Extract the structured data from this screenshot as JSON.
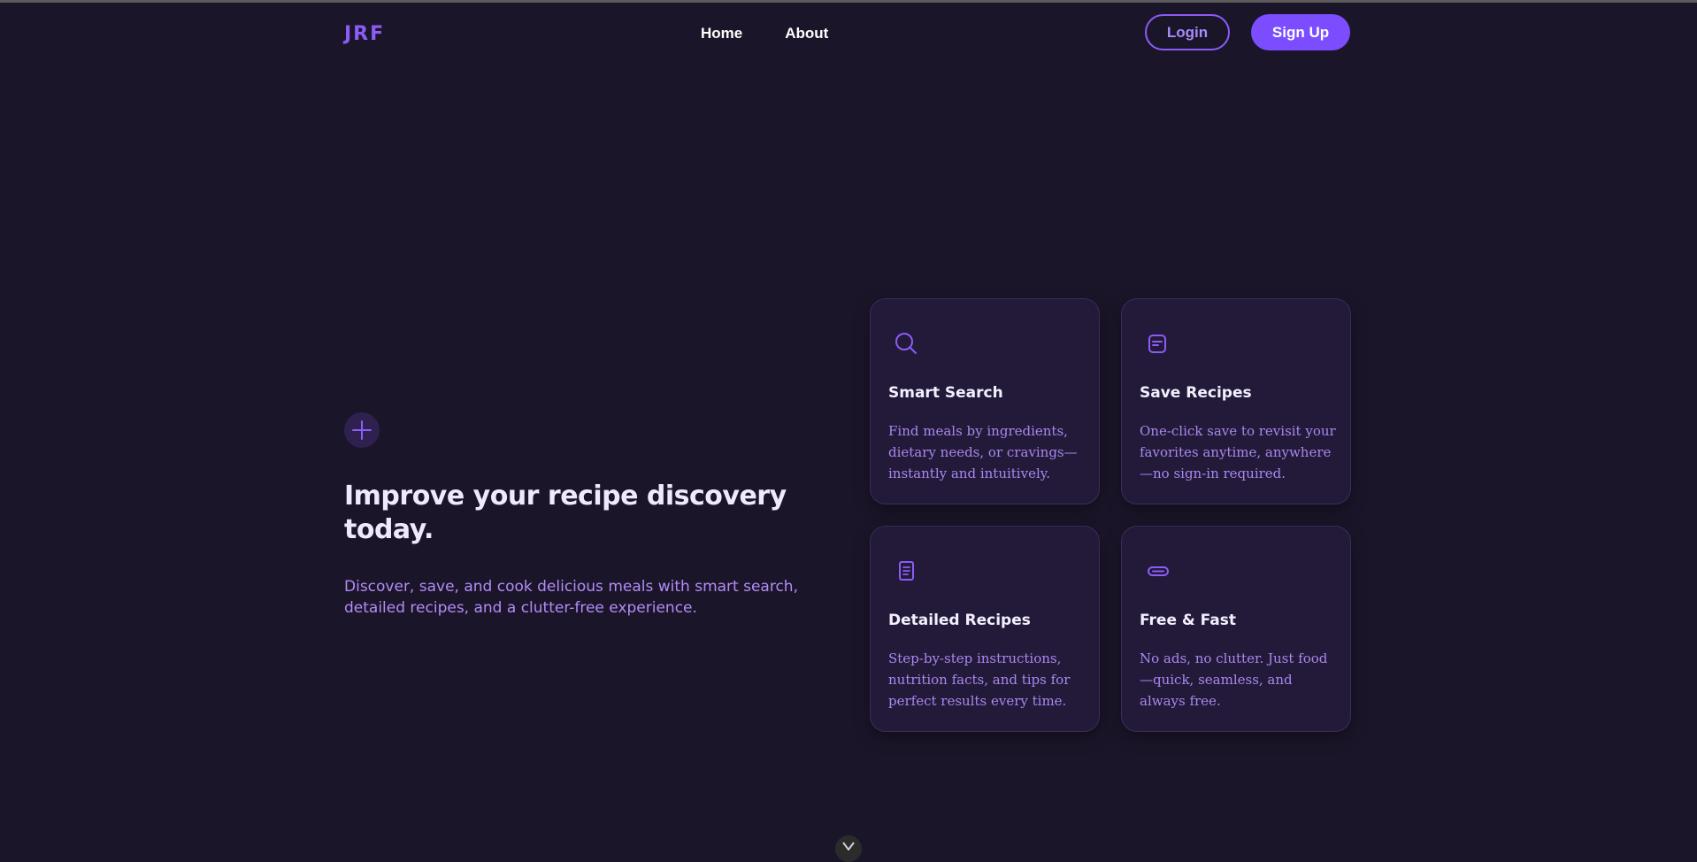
{
  "nav": {
    "logo": "JRF",
    "links": [
      "Home",
      "About"
    ],
    "login_label": "Login",
    "signup_label": "Sign Up"
  },
  "hero": {
    "icon": "plus-icon",
    "title": "Improve your recipe discovery today.",
    "subtitle": "Discover, save, and cook delicious meals with smart search, detailed recipes, and a clutter-free experience."
  },
  "features": [
    {
      "icon": "search-icon",
      "title": "Smart Search",
      "description": "Find meals by ingredients, dietary needs, or cravings—instantly and intuitively."
    },
    {
      "icon": "bookmark-note-icon",
      "title": "Save Recipes",
      "description": "One-click save to revisit your favorites anytime, anywhere—no sign-in required."
    },
    {
      "icon": "document-icon",
      "title": "Detailed Recipes",
      "description": "Step-by-step instructions, nutrition facts, and tips for perfect results every time."
    },
    {
      "icon": "link-icon",
      "title": "Free & Fast",
      "description": "No ads, no clutter. Just food—quick, seamless, and always free."
    }
  ],
  "scroll_indicator": "chevron-down-icon",
  "colors": {
    "background": "#1b1529",
    "accent": "#8b5cf6",
    "card_background": "#221a38",
    "description_text": "#a987f0"
  }
}
